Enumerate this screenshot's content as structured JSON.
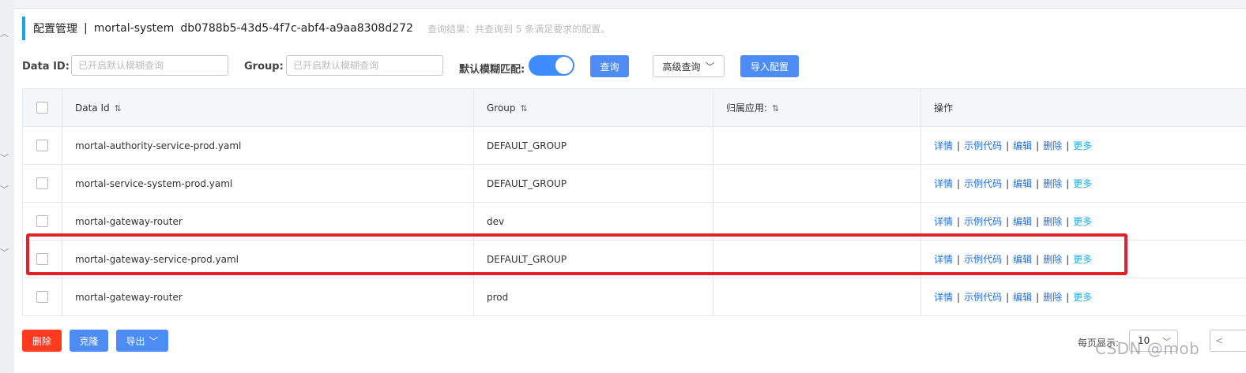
{
  "header": {
    "title": "配置管理",
    "separator": "|",
    "namespace_name": "mortal-system",
    "namespace_id": "db0788b5-43d5-4f7c-abf4-a9aa8308d272",
    "result_text": "查询结果：共查询到 5 条满足要求的配置。"
  },
  "filters": {
    "data_id_label": "Data ID:",
    "data_id_placeholder": "已开启默认模糊查询",
    "group_label": "Group:",
    "group_placeholder": "已开启默认模糊查询",
    "fuzzy_label": "默认模糊匹配:",
    "fuzzy_enabled": true,
    "query_button": "查询",
    "advanced_button": "高级查询",
    "import_button": "导入配置"
  },
  "table": {
    "columns": [
      "Data Id",
      "Group",
      "归属应用:",
      "操作"
    ],
    "sort_icon": "⇅",
    "rows": [
      {
        "data_id": "mortal-authority-service-prod.yaml",
        "group": "DEFAULT_GROUP",
        "app": ""
      },
      {
        "data_id": "mortal-service-system-prod.yaml",
        "group": "DEFAULT_GROUP",
        "app": ""
      },
      {
        "data_id": "mortal-gateway-router",
        "group": "dev",
        "app": ""
      },
      {
        "data_id": "mortal-gateway-service-prod.yaml",
        "group": "DEFAULT_GROUP",
        "app": ""
      },
      {
        "data_id": "mortal-gateway-router",
        "group": "prod",
        "app": ""
      }
    ],
    "actions": {
      "detail": "详情",
      "sample_code": "示例代码",
      "edit": "编辑",
      "delete": "删除",
      "more": "更多",
      "separator": "|"
    },
    "highlighted_row": 3
  },
  "footer": {
    "delete_button": "删除",
    "clone_button": "克隆",
    "export_button": "导出",
    "page_size_label": "每页显示:",
    "page_size_value": "10",
    "prev_text": "<",
    "watermark": "CSDN @mob"
  },
  "colors": {
    "primary": "#4d8cf5",
    "danger": "#ff3b1f",
    "highlight_border": "#e0202a",
    "link": "#1f6fd9",
    "header_accent": "#0ea5e9"
  }
}
